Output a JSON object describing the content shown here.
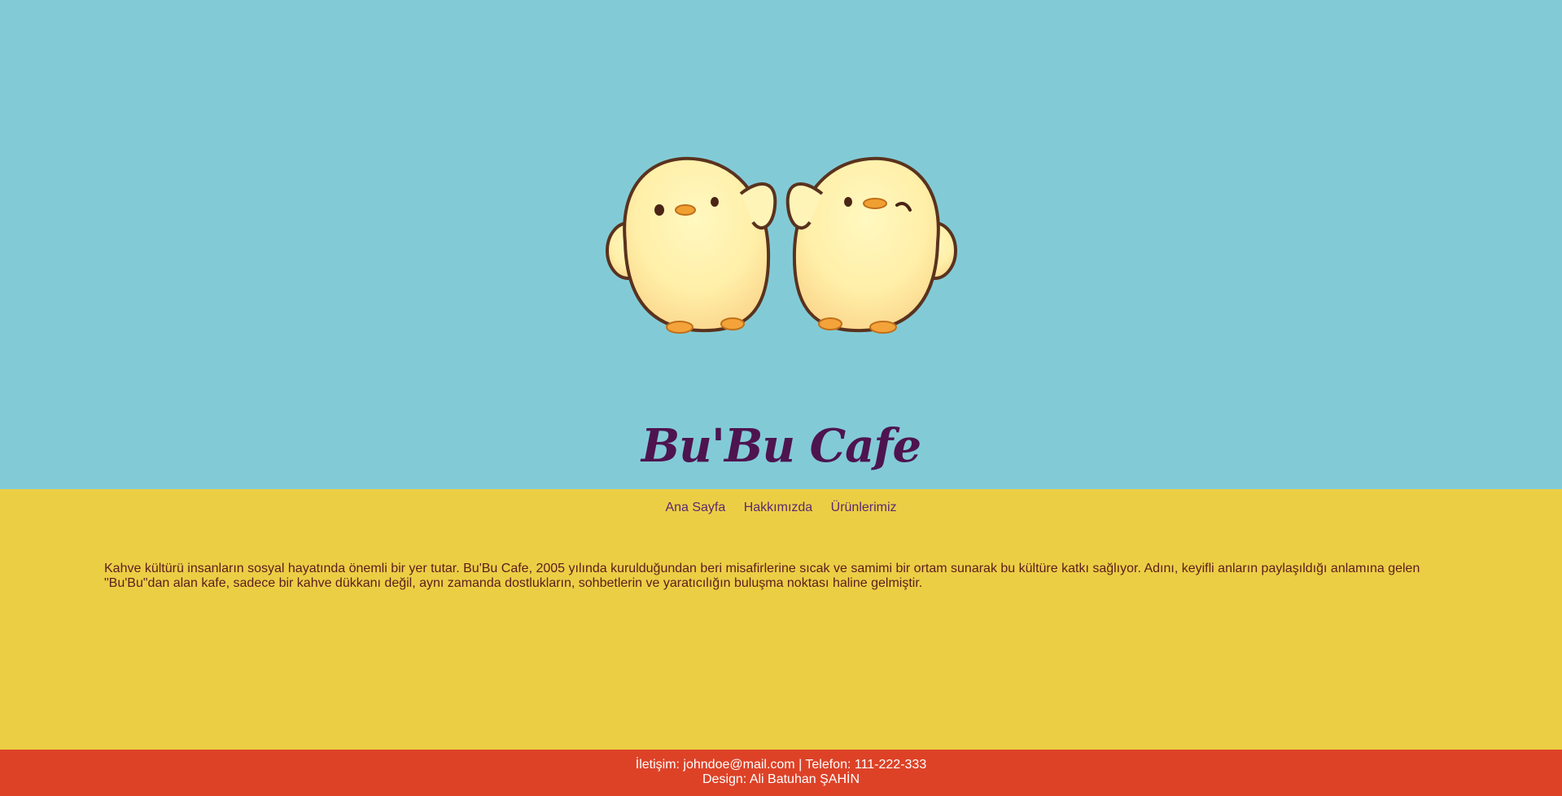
{
  "header": {
    "logo_icon": "two-chicks-logo",
    "title": "Bu'Bu Cafe"
  },
  "nav": {
    "items": [
      {
        "label": "Ana Sayfa"
      },
      {
        "label": "Hakkımızda"
      },
      {
        "label": "Ürünlerimiz"
      }
    ]
  },
  "main": {
    "intro": "Kahve kültürü insanların sosyal hayatında önemli bir yer tutar. Bu'Bu Cafe, 2005 yılında kurulduğundan beri misafirlerine sıcak ve samimi bir ortam sunarak bu kültüre katkı sağlıyor. Adını, keyifli anların paylaşıldığı anlamına gelen \"Bu'Bu\"dan alan kafe, sadece bir kahve dükkanı değil, aynı zamanda dostlukların, sohbetlerin ve yaratıcılığın buluşma noktası haline gelmiştir."
  },
  "footer": {
    "contact": "İletişim: johndoe@mail.com | Telefon: 111-222-333",
    "design": "Design: Ali Batuhan ŞAHİN"
  },
  "colors": {
    "hero_bg": "#82cbd6",
    "content_bg": "#ecce45",
    "footer_bg": "#dd4227",
    "title": "#4e1450"
  }
}
